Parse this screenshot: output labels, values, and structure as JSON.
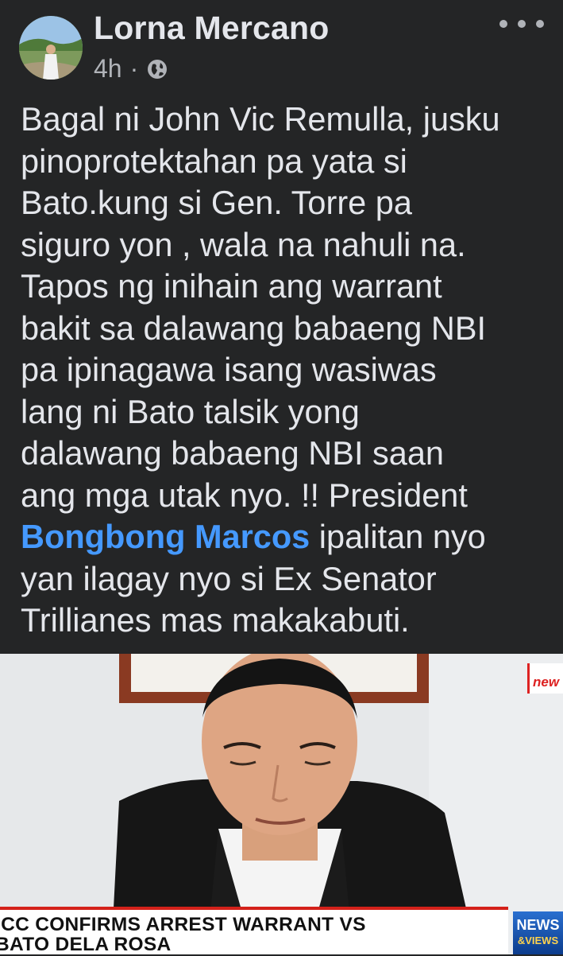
{
  "post": {
    "author": "Lorna Mercano",
    "time": "4h",
    "separator": "·",
    "privacy_icon": "globe-icon",
    "more_icon": "more-options-icon",
    "text_lines": [
      "Bagal ni John Vic Remulla, jusku",
      "pinoprotektahan pa yata si",
      "Bato.kung si Gen. Torre pa",
      "siguro yon , wala na nahuli na.",
      "Tapos ng inihain ang warrant",
      "bakit sa dalawang babaeng NBI",
      "pa ipinagawa isang wasiwas",
      "lang ni Bato talsik yong",
      "dalawang babaeng NBI saan",
      "ang mga utak nyo. !! President"
    ],
    "mention": "Bongbong Marcos",
    "mention_suffix": " ipalitan nyo",
    "text_lines_end": [
      "yan ilagay nyo si Ex Senator",
      "Trillianes mas makakabuti."
    ]
  },
  "media": {
    "ticker_line1": "ICC CONFIRMS ARREST WARRANT VS",
    "ticker_line2": "BATO DELA ROSA",
    "news_logo": "NEWS",
    "news_logo_sub": "&VIEWS",
    "brand_tag": "new"
  },
  "colors": {
    "background": "#242526",
    "text": "#e4e6eb",
    "secondary_text": "#b0b3b8",
    "mention": "#4599ff",
    "ticker_accent": "#d4211a"
  }
}
